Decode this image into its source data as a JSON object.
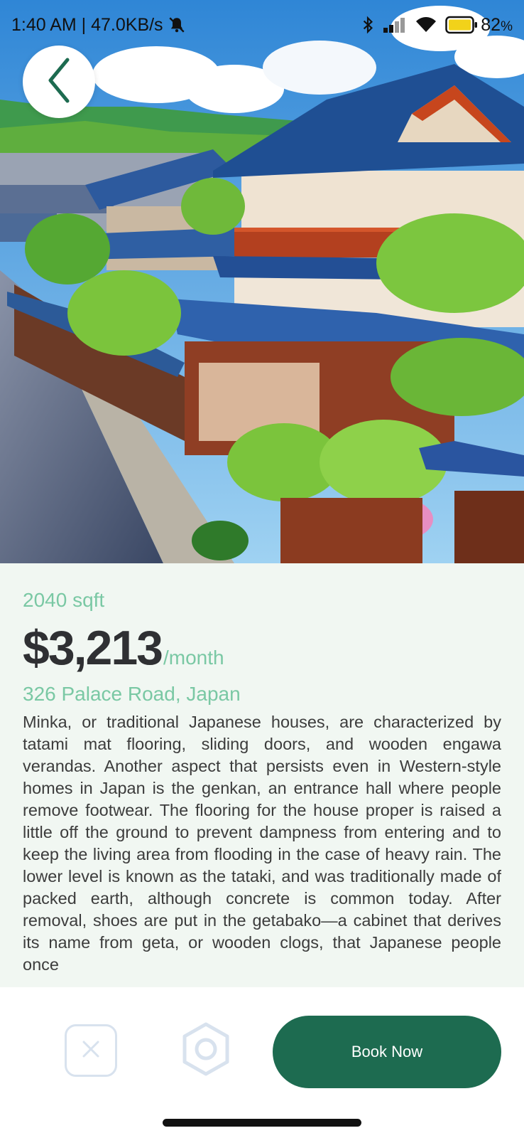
{
  "status_bar": {
    "time_and_speed": "1:40 AM | 47.0KB/s",
    "battery_percent": "82",
    "battery_suffix": "%",
    "icons": [
      "mute-bell-icon",
      "bluetooth-icon",
      "signal-icon",
      "wifi-icon",
      "battery-icon"
    ]
  },
  "hero": {
    "image": "traditional-japanese-street-illustration"
  },
  "navigation": {
    "back_icon": "chevron-left-icon"
  },
  "listing": {
    "area": "2040 sqft",
    "price": "$3,213",
    "per_period": "/month",
    "address": "326 Palace Road, Japan",
    "description": "Minka, or traditional Japanese houses, are characterized by tatami mat flooring, sliding doors, and wooden engawa verandas. Another aspect that persists even in Western-style homes in Japan is the genkan, an entrance hall where people remove footwear. The flooring for the house proper is raised a little off the ground to prevent dampness from entering and to keep the living area from flooding in the case of heavy rain. The lower level is known as the tataki, and was traditionally made of packed earth, although concrete is common today. After removal, shoes are put in the getabako—a cabinet that derives its name from geta, or wooden clogs, that Japanese people once"
  },
  "actions": {
    "close_icon": "close-icon",
    "hexagon_icon": "hexagon-icon",
    "book_label": "Book Now"
  },
  "colors": {
    "accent": "#1d6b50",
    "accent_light": "#7ac8a4",
    "background": "#f1f7f2"
  }
}
